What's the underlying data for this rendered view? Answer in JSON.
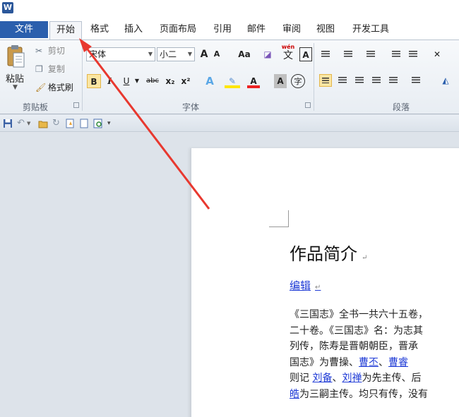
{
  "app": {
    "icon_letter": "W"
  },
  "tabs": {
    "file": "文件",
    "items": [
      "开始",
      "格式",
      "插入",
      "页面布局",
      "引用",
      "邮件",
      "审阅",
      "视图",
      "开发工具"
    ]
  },
  "clipboard": {
    "paste": "粘贴",
    "cut": "剪切",
    "copy": "复制",
    "format_painter": "格式刷",
    "group_label": "剪贴板"
  },
  "font": {
    "family": "宋体",
    "size": "小二",
    "grow": "A",
    "shrink": "A",
    "case": "Aa",
    "phonetic": "wén",
    "phonetic_char": "文",
    "border_char": "A",
    "bold": "B",
    "italic": "I",
    "underline": "U",
    "strike": "abc",
    "subscript": "x₂",
    "superscript": "x²",
    "effects": "A",
    "font_color": "A",
    "char_shading": "A",
    "enclose": "字",
    "group_label": "字体"
  },
  "paragraph": {
    "group_label": "段落"
  },
  "document": {
    "title": "作品简介",
    "edit_link": "编辑",
    "lines": [
      {
        "segments": [
          {
            "text": "《三国志》全书一共六十五卷，",
            "link": false
          }
        ]
      },
      {
        "segments": [
          {
            "text": "二十卷。《三国志》名：为志其",
            "link": false
          }
        ]
      },
      {
        "segments": [
          {
            "text": "列传，陈寿是晋朝朝臣，晋承",
            "link": false
          }
        ]
      },
      {
        "segments": [
          {
            "text": "国志》为",
            "link": false
          },
          {
            "text": "曹操",
            "link": false
          },
          {
            "text": "、",
            "link": false
          },
          {
            "text": "曹丕",
            "link": true
          },
          {
            "text": "、",
            "link": false
          },
          {
            "text": "曹睿",
            "link": true
          }
        ]
      },
      {
        "segments": [
          {
            "text": "则记 ",
            "link": false
          },
          {
            "text": "刘备",
            "link": true
          },
          {
            "text": "、",
            "link": false
          },
          {
            "text": "刘禅",
            "link": true
          },
          {
            "text": "为先主传、后",
            "link": false
          }
        ]
      },
      {
        "segments": [
          {
            "text": "皓",
            "link": true
          },
          {
            "text": "为三嗣主传。均只有传，没有",
            "link": false
          }
        ]
      }
    ]
  },
  "colors": {
    "file_tab": "#2b5fad",
    "accent_highlight": "#fbe6a3",
    "link": "#1f3bd6",
    "arrow": "#e8382f"
  }
}
